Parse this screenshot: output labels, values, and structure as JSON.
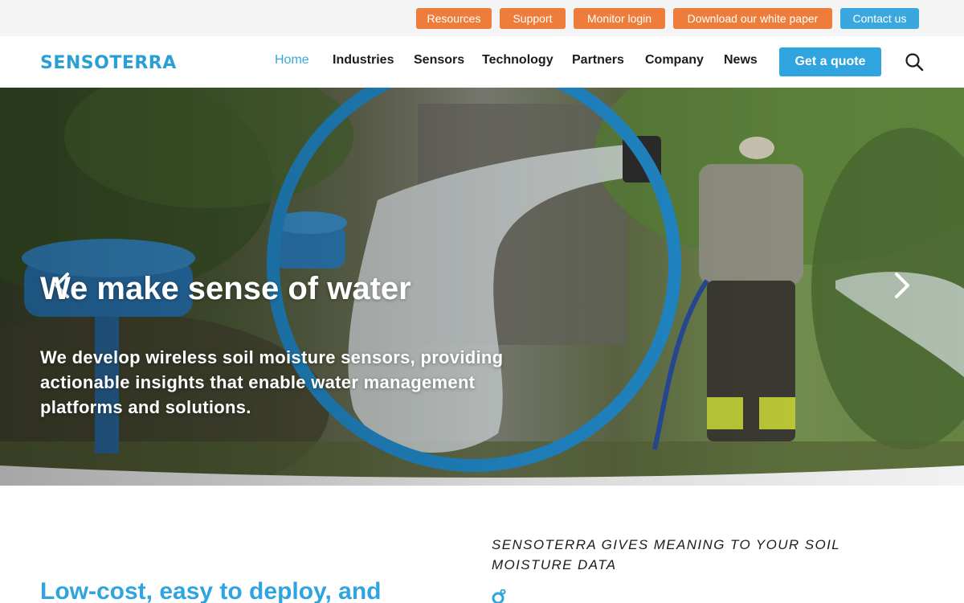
{
  "topbar": {
    "buttons": [
      {
        "label": "Resources"
      },
      {
        "label": "Support"
      },
      {
        "label": "Monitor login"
      },
      {
        "label": "Download our white paper"
      },
      {
        "label": "Contact us"
      }
    ]
  },
  "nav": {
    "logo": "SENSOTERRA",
    "links": [
      "Home",
      "Industries",
      "Sensors",
      "Technology",
      "Partners",
      "Company",
      "News"
    ],
    "active": "Home",
    "cta": "Get a quote",
    "search_icon": "search-icon"
  },
  "hero": {
    "title": "We make sense of water",
    "subtitle": "We develop wireless soil moisture sensors, providing actionable insights that enable water management platforms and solutions.",
    "prev_icon": "chevron-left-icon",
    "next_icon": "chevron-right-icon"
  },
  "content": {
    "eyebrow": "SENSOTERRA GIVES MEANING TO YOUR SOIL MOISTURE DATA",
    "heading": "Low-cost, easy to deploy, and"
  },
  "colors": {
    "brand_blue": "#2fa4df",
    "orange": "#ee7d3b",
    "topbar_bg": "#f4f4f4"
  }
}
